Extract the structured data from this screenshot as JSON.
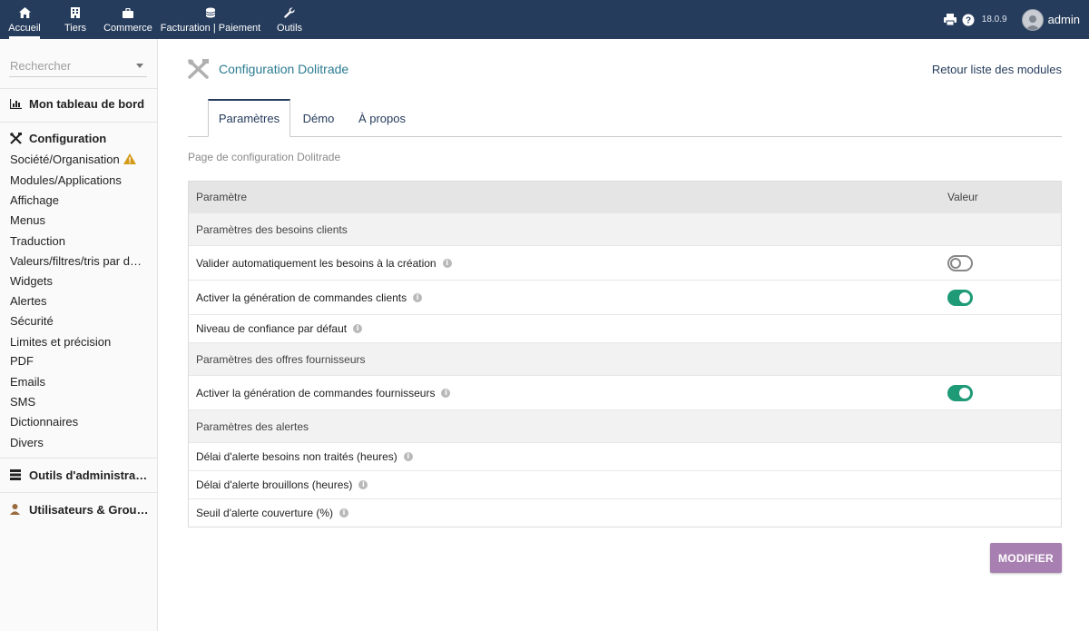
{
  "topnav": {
    "items": [
      {
        "label": "Accueil",
        "icon": "home-icon"
      },
      {
        "label": "Tiers",
        "icon": "building-icon"
      },
      {
        "label": "Commerce",
        "icon": "briefcase-icon"
      },
      {
        "label": "Facturation | Paiement",
        "icon": "coins-icon"
      },
      {
        "label": "Outils",
        "icon": "wrench-icon"
      }
    ],
    "version": "18.0.9",
    "user": "admin"
  },
  "sidebar": {
    "search_placeholder": "Rechercher",
    "dashboard": "Mon tableau de bord",
    "configuration": "Configuration",
    "config_items": [
      "Société/Organisation",
      "Modules/Applications",
      "Affichage",
      "Menus",
      "Traduction",
      "Valeurs/filtres/tris par défaut",
      "Widgets",
      "Alertes",
      "Sécurité",
      "Limites et précision",
      "PDF",
      "Emails",
      "SMS",
      "Dictionnaires",
      "Divers"
    ],
    "admin_tools": "Outils d'administration",
    "users_groups": "Utilisateurs & Groupes"
  },
  "main": {
    "title": "Configuration Dolitrade",
    "back_link": "Retour liste des modules",
    "tabs": [
      "Paramètres",
      "Démo",
      "À propos"
    ],
    "description": "Page de configuration Dolitrade",
    "table": {
      "col_param": "Paramètre",
      "col_value": "Valeur",
      "section_clients": "Paramètres des besoins clients",
      "p_auto_validate": "Valider automatiquement les besoins à la création",
      "p_gen_orders_clients": "Activer la génération de commandes clients",
      "p_confidence": "Niveau de confiance par défaut",
      "section_suppliers": "Paramètres des offres fournisseurs",
      "p_gen_orders_suppliers": "Activer la génération de commandes fournisseurs",
      "section_alerts": "Paramètres des alertes",
      "p_delay_untreated": "Délai d'alerte besoins non traités (heures)",
      "p_delay_drafts": "Délai d'alerte brouillons (heures)",
      "p_coverage": "Seuil d'alerte couverture (%)"
    },
    "toggles": {
      "auto_validate": false,
      "gen_orders_clients": true,
      "gen_orders_suppliers": true
    },
    "modify_button": "MODIFIER"
  },
  "colors": {
    "topbar": "#263c5c",
    "accent_title": "#2b7b8f",
    "toggle_on": "#1f9a76",
    "button": "#a77fb1",
    "warning": "#d39a1a"
  }
}
